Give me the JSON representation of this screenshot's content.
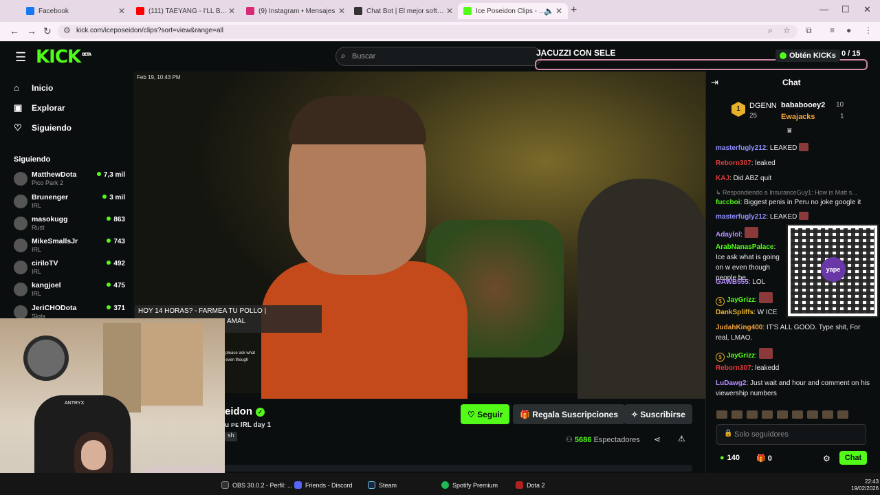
{
  "browser": {
    "tabs": [
      {
        "label": "Facebook",
        "color": "#1877f2"
      },
      {
        "label": "(111) TAEYANG - I'LL BE THERE",
        "color": "#ff0000"
      },
      {
        "label": "(9) Instagram • Mensajes",
        "color": "#d62976"
      },
      {
        "label": "Chat Bot | El mejor software pa",
        "color": "#333333"
      },
      {
        "label": "Ice Poseidon Clips - Watch",
        "color": "#53fc18"
      }
    ],
    "url": "kick.com/iceposeidon/clips?sort=view&range=all"
  },
  "header": {
    "logo": "KICK",
    "logo_badge": "BETA",
    "search_placeholder": "Buscar",
    "overlay_title": "JACUZZI CON SELE",
    "kicks_button": "Obtén KICKs",
    "counter": "0 / 15"
  },
  "sidebar": {
    "nav": [
      {
        "label": "Inicio",
        "icon": "home-icon"
      },
      {
        "label": "Explorar",
        "icon": "explore-icon"
      },
      {
        "label": "Siguiendo",
        "icon": "heart-icon"
      }
    ],
    "following_header": "Siguiendo",
    "following": [
      {
        "name": "MatthewDota",
        "category": "Pico Park 2",
        "viewers": "7,3 mil"
      },
      {
        "name": "Brunenger",
        "category": "IRL",
        "viewers": "3 mil"
      },
      {
        "name": "masokugg",
        "category": "Rust",
        "viewers": "863"
      },
      {
        "name": "MikeSmallsJr",
        "category": "IRL",
        "viewers": "743"
      },
      {
        "name": "ciriloTV",
        "category": "IRL",
        "viewers": "492"
      },
      {
        "name": "kangjoel",
        "category": "IRL",
        "viewers": "475"
      },
      {
        "name": "JeriCHODota",
        "category": "Slots",
        "viewers": "371"
      }
    ]
  },
  "video": {
    "date": "Feb 19, 10:43 PM",
    "caption_line1": "HOY 14 HORAS? - FARMEA TU POLLO |",
    "caption_line2": "AMAL",
    "tiny_caption1": "please ask what",
    "tiny_caption2": "even though"
  },
  "channel": {
    "name": "eidon",
    "title": "u ᴘᴇ IRL day 1",
    "tag": "sh",
    "follow_button": "Seguir",
    "gift_button": "Regala Suscripciones",
    "subscribe_button": "Suscribirse",
    "viewers_count": "5686",
    "viewers_label": "Espectadores"
  },
  "chat": {
    "title": "Chat",
    "top_gifter_rank": "1",
    "top_gifter": "DGENN",
    "top_gifter_count": "25",
    "gifter2": "bababooey2",
    "gifter2_count": "10",
    "gifter3": "Ewajacks",
    "gifter3_count": "1",
    "messages": [
      {
        "user": "masterfugly212",
        "color": "#8f8fff",
        "text": ": LEAKED"
      },
      {
        "user": "Reborn307",
        "color": "#e03a3a",
        "text": ": leaked"
      },
      {
        "user": "KAJ",
        "color": "#e03a3a",
        "text": ": Did ABZ quit"
      },
      {
        "user": "fuccboi",
        "color": "#53fc18",
        "text": ": Biggest penis in Peru no joke google it"
      },
      {
        "user": "masterfugly212",
        "color": "#8f8fff",
        "text": ": LEAKED"
      },
      {
        "user": "Adaylol",
        "color": "#b58cff",
        "text": ":"
      },
      {
        "user": "ArabNanasPalace",
        "color": "#53fc18",
        "text": ": Ice ask what is going on w even though people be"
      },
      {
        "user": "GAWB555",
        "color": "#b58cff",
        "text": ": LOL"
      },
      {
        "user": "JayGrizz",
        "color": "#53fc18",
        "text": ":"
      },
      {
        "user": "DankSpliffs",
        "color": "#e7b12a",
        "text": ": W ICE"
      },
      {
        "user": "JudahKing400",
        "color": "#f2a33a",
        "text": ": IT'S ALL GOOD. Type shit, For real, LMAO."
      },
      {
        "user": "JayGrizz",
        "color": "#53fc18",
        "text": ":"
      },
      {
        "user": "Reborn307",
        "color": "#e03a3a",
        "text": ": leakedd"
      },
      {
        "user": "LuDawg2",
        "color": "#b58cff",
        "text": ": Just wait and hour and comment on his viewership numbers"
      }
    ],
    "reply_text": "Respondiendo a InsuranceGuy1: How is Matt s...",
    "qr_label": "yape",
    "input_placeholder": "Solo seguidores",
    "kicks": "140",
    "gifts": "0",
    "send_button": "Chat"
  },
  "taskbar": {
    "items": [
      "OBS 30.0.2 - Perfil: ...",
      "Friends - Discord",
      "Steam",
      "Spotify Premium",
      "Dota 2"
    ],
    "time": "22:43",
    "date": "19/02/2026"
  },
  "webcam": {
    "chair_brand": "ANTRYX"
  }
}
